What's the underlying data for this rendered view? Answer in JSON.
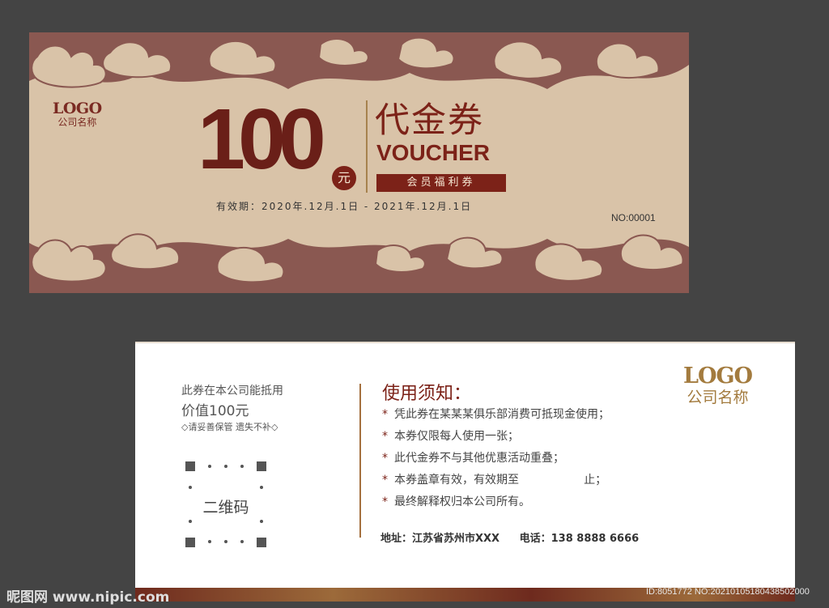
{
  "front": {
    "logo_text": "LOGO",
    "company_name": "公司名称",
    "amount": "100",
    "currency": "元",
    "title_cn": "代金券",
    "title_en": "VOUCHER",
    "tagline": "会员福利券",
    "validity": "有效期：2020年.12月.1日 - 2021年.12月.1日",
    "serial": "NO:00001",
    "colors": {
      "background": "#d9c3a8",
      "border_band": "#8a5851",
      "accent": "#7c2218"
    }
  },
  "back": {
    "value_line1": "此券在本公司能抵用",
    "value_line2": "价值100元",
    "keep_note": "◇请妥善保管 遗失不补◇",
    "qr_label": "二维码",
    "notice_title": "使用须知：",
    "rules": [
      "凭此券在某某某俱乐部消费可抵现金使用；",
      "本券仅限每人使用一张；",
      "此代金券不与其他优惠活动重叠；",
      "本券盖章有效，有效期至                  止；",
      "最终解释权归本公司所有。"
    ],
    "bullet": "*",
    "address": "地址：江苏省苏州市XXX",
    "phone": "电话：138 8888 6666",
    "logo_text": "LOGO",
    "company_name": "公司名称"
  },
  "watermark": {
    "left": "昵图网 www.nipic.com",
    "right": "ID:8051772 NO:20210105180438502000"
  }
}
